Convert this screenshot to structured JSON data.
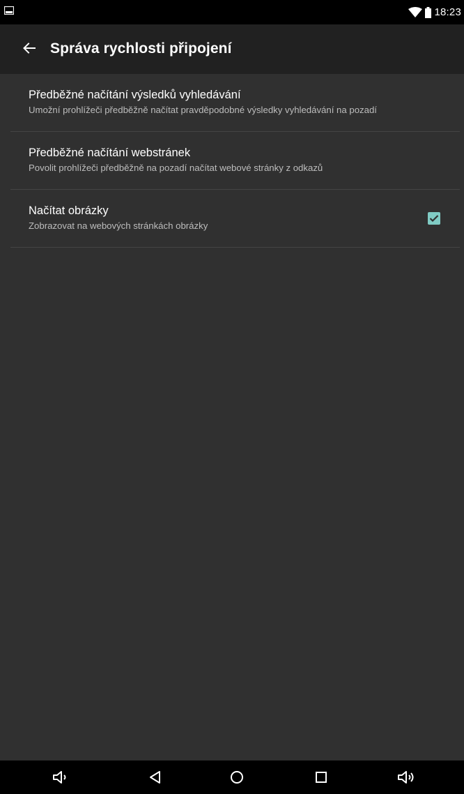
{
  "status_bar": {
    "time": "18:23",
    "left_icon": "image-notification-icon",
    "right_icons": [
      "wifi-icon",
      "battery-icon"
    ]
  },
  "toolbar": {
    "title": "Správa rychlosti připojení",
    "back_icon": "arrow-back-icon"
  },
  "preferences": [
    {
      "title": "Předběžné načítání výsledků vyhledávání",
      "summary": "Umožní prohlížeči předběžně načítat pravděpodobné výsledky vyhledávání na pozadí",
      "has_checkbox": false
    },
    {
      "title": "Předběžné načítání webstránek",
      "summary": "Povolit prohlížeči předběžně na pozadí načítat webové stránky z odkazů",
      "has_checkbox": false
    },
    {
      "title": "Načítat obrázky",
      "summary": "Zobrazovat na webových stránkách obrázky",
      "has_checkbox": true,
      "checked": true
    }
  ],
  "nav_bar": {
    "buttons": [
      "volume-down-icon",
      "back-triangle-icon",
      "home-circle-icon",
      "recents-square-icon",
      "volume-up-icon"
    ]
  },
  "colors": {
    "background": "#303030",
    "toolbar": "#212121",
    "accent": "#80cbc4",
    "divider": "#444444"
  }
}
